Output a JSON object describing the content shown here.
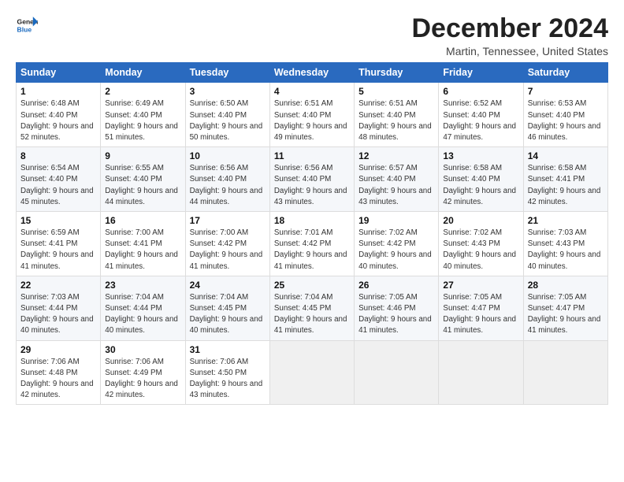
{
  "logo": {
    "line1": "General",
    "line2": "Blue"
  },
  "title": "December 2024",
  "location": "Martin, Tennessee, United States",
  "days_of_week": [
    "Sunday",
    "Monday",
    "Tuesday",
    "Wednesday",
    "Thursday",
    "Friday",
    "Saturday"
  ],
  "weeks": [
    [
      {
        "day": "1",
        "sunrise": "6:48 AM",
        "sunset": "4:40 PM",
        "daylight": "9 hours and 52 minutes."
      },
      {
        "day": "2",
        "sunrise": "6:49 AM",
        "sunset": "4:40 PM",
        "daylight": "9 hours and 51 minutes."
      },
      {
        "day": "3",
        "sunrise": "6:50 AM",
        "sunset": "4:40 PM",
        "daylight": "9 hours and 50 minutes."
      },
      {
        "day": "4",
        "sunrise": "6:51 AM",
        "sunset": "4:40 PM",
        "daylight": "9 hours and 49 minutes."
      },
      {
        "day": "5",
        "sunrise": "6:51 AM",
        "sunset": "4:40 PM",
        "daylight": "9 hours and 48 minutes."
      },
      {
        "day": "6",
        "sunrise": "6:52 AM",
        "sunset": "4:40 PM",
        "daylight": "9 hours and 47 minutes."
      },
      {
        "day": "7",
        "sunrise": "6:53 AM",
        "sunset": "4:40 PM",
        "daylight": "9 hours and 46 minutes."
      }
    ],
    [
      {
        "day": "8",
        "sunrise": "6:54 AM",
        "sunset": "4:40 PM",
        "daylight": "9 hours and 45 minutes."
      },
      {
        "day": "9",
        "sunrise": "6:55 AM",
        "sunset": "4:40 PM",
        "daylight": "9 hours and 44 minutes."
      },
      {
        "day": "10",
        "sunrise": "6:56 AM",
        "sunset": "4:40 PM",
        "daylight": "9 hours and 44 minutes."
      },
      {
        "day": "11",
        "sunrise": "6:56 AM",
        "sunset": "4:40 PM",
        "daylight": "9 hours and 43 minutes."
      },
      {
        "day": "12",
        "sunrise": "6:57 AM",
        "sunset": "4:40 PM",
        "daylight": "9 hours and 43 minutes."
      },
      {
        "day": "13",
        "sunrise": "6:58 AM",
        "sunset": "4:40 PM",
        "daylight": "9 hours and 42 minutes."
      },
      {
        "day": "14",
        "sunrise": "6:58 AM",
        "sunset": "4:41 PM",
        "daylight": "9 hours and 42 minutes."
      }
    ],
    [
      {
        "day": "15",
        "sunrise": "6:59 AM",
        "sunset": "4:41 PM",
        "daylight": "9 hours and 41 minutes."
      },
      {
        "day": "16",
        "sunrise": "7:00 AM",
        "sunset": "4:41 PM",
        "daylight": "9 hours and 41 minutes."
      },
      {
        "day": "17",
        "sunrise": "7:00 AM",
        "sunset": "4:42 PM",
        "daylight": "9 hours and 41 minutes."
      },
      {
        "day": "18",
        "sunrise": "7:01 AM",
        "sunset": "4:42 PM",
        "daylight": "9 hours and 41 minutes."
      },
      {
        "day": "19",
        "sunrise": "7:02 AM",
        "sunset": "4:42 PM",
        "daylight": "9 hours and 40 minutes."
      },
      {
        "day": "20",
        "sunrise": "7:02 AM",
        "sunset": "4:43 PM",
        "daylight": "9 hours and 40 minutes."
      },
      {
        "day": "21",
        "sunrise": "7:03 AM",
        "sunset": "4:43 PM",
        "daylight": "9 hours and 40 minutes."
      }
    ],
    [
      {
        "day": "22",
        "sunrise": "7:03 AM",
        "sunset": "4:44 PM",
        "daylight": "9 hours and 40 minutes."
      },
      {
        "day": "23",
        "sunrise": "7:04 AM",
        "sunset": "4:44 PM",
        "daylight": "9 hours and 40 minutes."
      },
      {
        "day": "24",
        "sunrise": "7:04 AM",
        "sunset": "4:45 PM",
        "daylight": "9 hours and 40 minutes."
      },
      {
        "day": "25",
        "sunrise": "7:04 AM",
        "sunset": "4:45 PM",
        "daylight": "9 hours and 41 minutes."
      },
      {
        "day": "26",
        "sunrise": "7:05 AM",
        "sunset": "4:46 PM",
        "daylight": "9 hours and 41 minutes."
      },
      {
        "day": "27",
        "sunrise": "7:05 AM",
        "sunset": "4:47 PM",
        "daylight": "9 hours and 41 minutes."
      },
      {
        "day": "28",
        "sunrise": "7:05 AM",
        "sunset": "4:47 PM",
        "daylight": "9 hours and 41 minutes."
      }
    ],
    [
      {
        "day": "29",
        "sunrise": "7:06 AM",
        "sunset": "4:48 PM",
        "daylight": "9 hours and 42 minutes."
      },
      {
        "day": "30",
        "sunrise": "7:06 AM",
        "sunset": "4:49 PM",
        "daylight": "9 hours and 42 minutes."
      },
      {
        "day": "31",
        "sunrise": "7:06 AM",
        "sunset": "4:50 PM",
        "daylight": "9 hours and 43 minutes."
      },
      null,
      null,
      null,
      null
    ]
  ]
}
